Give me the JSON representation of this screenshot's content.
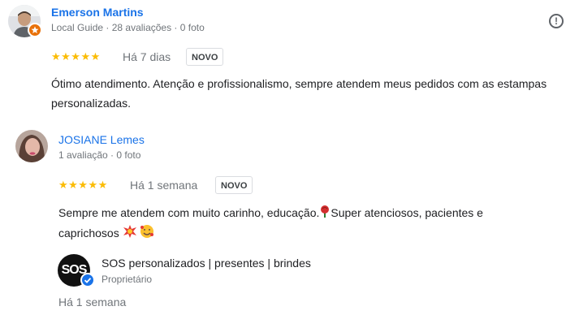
{
  "reviews": [
    {
      "name": "Emerson Martins",
      "meta": "Local Guide · 28 avaliações · 0 foto",
      "stars": "★★★★★",
      "when": "Há 7 dias",
      "badge": "NOVO",
      "text": "Ótimo atendimento. Atenção e profissionalismo, sempre atendem meus pedidos com as estampas personalizadas."
    },
    {
      "name": "JOSIANE Lemes",
      "meta": "1 avaliação · 0 foto",
      "stars": "★★★★★",
      "when": "Há 1 semana",
      "badge": "NOVO",
      "text_part1": "Sempre me atendem com muito carinho, educação.",
      "text_part2": "Super atenciosos, pacientes e",
      "text_line2": "caprichosos"
    }
  ],
  "owner_response": {
    "name": "SOS personalizados | presentes | brindes",
    "role": "Proprietário",
    "when": "Há 1 semana",
    "logo_text": "SOS"
  },
  "icons": {
    "report": "!",
    "local_guide_badge": "local-guide-icon",
    "verified": "verified-check-icon",
    "rose": "rose-emoji",
    "collision": "collision-emoji",
    "smiling_hearts": "smiling-face-with-hearts-emoji"
  },
  "colors": {
    "name_link": "#1a73e8",
    "star": "#fbbc04",
    "local_guide": "#e8710a",
    "verified": "#1a73e8"
  }
}
